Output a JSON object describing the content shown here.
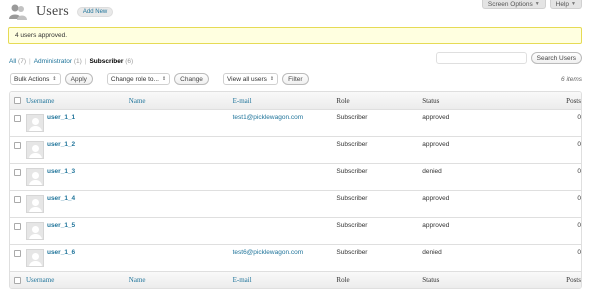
{
  "screen_options": {
    "screen_options_label": "Screen Options",
    "help_label": "Help"
  },
  "header": {
    "title": "Users",
    "add_new_label": "Add New"
  },
  "notice": {
    "message": "4 users approved."
  },
  "filters": {
    "all_label": "All",
    "all_count": "(7)",
    "admin_label": "Administrator",
    "admin_count": "(1)",
    "subscriber_label": "Subscriber",
    "subscriber_count": "(6)"
  },
  "search": {
    "button_label": "Search Users",
    "placeholder": ""
  },
  "tablenav": {
    "bulk_actions": "Bulk Actions",
    "apply_label": "Apply",
    "change_role": "Change role to...",
    "change_label": "Change",
    "view_all": "View all users",
    "filter_label": "Filter",
    "items_count": "6 items"
  },
  "columns": {
    "username": "Username",
    "name": "Name",
    "email": "E-mail",
    "role": "Role",
    "status": "Status",
    "posts": "Posts"
  },
  "rows": [
    {
      "username": "user_1_1",
      "name": "",
      "email": "test1@picklewagon.com",
      "role": "Subscriber",
      "status": "approved",
      "posts": "0"
    },
    {
      "username": "user_1_2",
      "name": "",
      "email": "",
      "role": "Subscriber",
      "status": "approved",
      "posts": "0"
    },
    {
      "username": "user_1_3",
      "name": "",
      "email": "",
      "role": "Subscriber",
      "status": "denied",
      "posts": "0"
    },
    {
      "username": "user_1_4",
      "name": "",
      "email": "",
      "role": "Subscriber",
      "status": "approved",
      "posts": "0"
    },
    {
      "username": "user_1_5",
      "name": "",
      "email": "",
      "role": "Subscriber",
      "status": "approved",
      "posts": "0"
    },
    {
      "username": "user_1_6",
      "name": "",
      "email": "test6@picklewagon.com",
      "role": "Subscriber",
      "status": "denied",
      "posts": "0"
    }
  ],
  "colors": {
    "link": "#21759b",
    "notice_bg": "#ffffe0",
    "notice_border": "#e6db55"
  },
  "icons": {
    "users": "users-icon",
    "avatar": "default-avatar-icon"
  }
}
